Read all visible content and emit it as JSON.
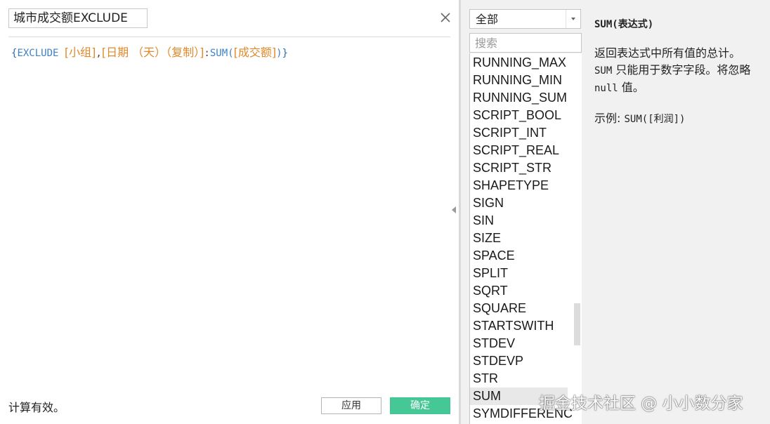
{
  "editor": {
    "calc_name": "城市成交额EXCLUDE",
    "formula": {
      "open_brace": "{",
      "keyword": "EXCLUDE",
      "space": " ",
      "field1": "[小组]",
      "comma": ",",
      "field2": "[日期 （天）（复制）]",
      "colon": ":",
      "func": "SUM",
      "open_paren": "(",
      "field3": "[成交额]",
      "close_paren": ")",
      "close_brace": "}"
    },
    "status": "计算有效。",
    "apply_label": "应用",
    "ok_label": "确定"
  },
  "functions": {
    "category": "全部",
    "search_placeholder": "搜索",
    "items": [
      "RUNNING_MAX",
      "RUNNING_MIN",
      "RUNNING_SUM",
      "SCRIPT_BOOL",
      "SCRIPT_INT",
      "SCRIPT_REAL",
      "SCRIPT_STR",
      "SHAPETYPE",
      "SIGN",
      "SIN",
      "SIZE",
      "SPACE",
      "SPLIT",
      "SQRT",
      "SQUARE",
      "STARTSWITH",
      "STDEV",
      "STDEVP",
      "STR",
      "SUM",
      "SYMDIFFERENCE"
    ],
    "selected": "SUM"
  },
  "doc": {
    "title": "SUM(表达式)",
    "desc_part1": "返回表达式中所有值的总计。",
    "desc_code1": "SUM",
    "desc_part2": " 只能用于数字字段。将忽略 ",
    "desc_code2": "null",
    "desc_part3": " 值。",
    "example_label": "示例: ",
    "example_code": "SUM([利润])"
  },
  "watermark": "掘金技术社区 @ 小小数分家",
  "icons": {
    "close": "close-icon",
    "dropdown": "chevron-down-icon",
    "splitter": "collapse-left-icon"
  },
  "colors": {
    "ok_button": "#45c896",
    "field_token": "#e0892a",
    "keyword_token": "#3f82c2"
  }
}
